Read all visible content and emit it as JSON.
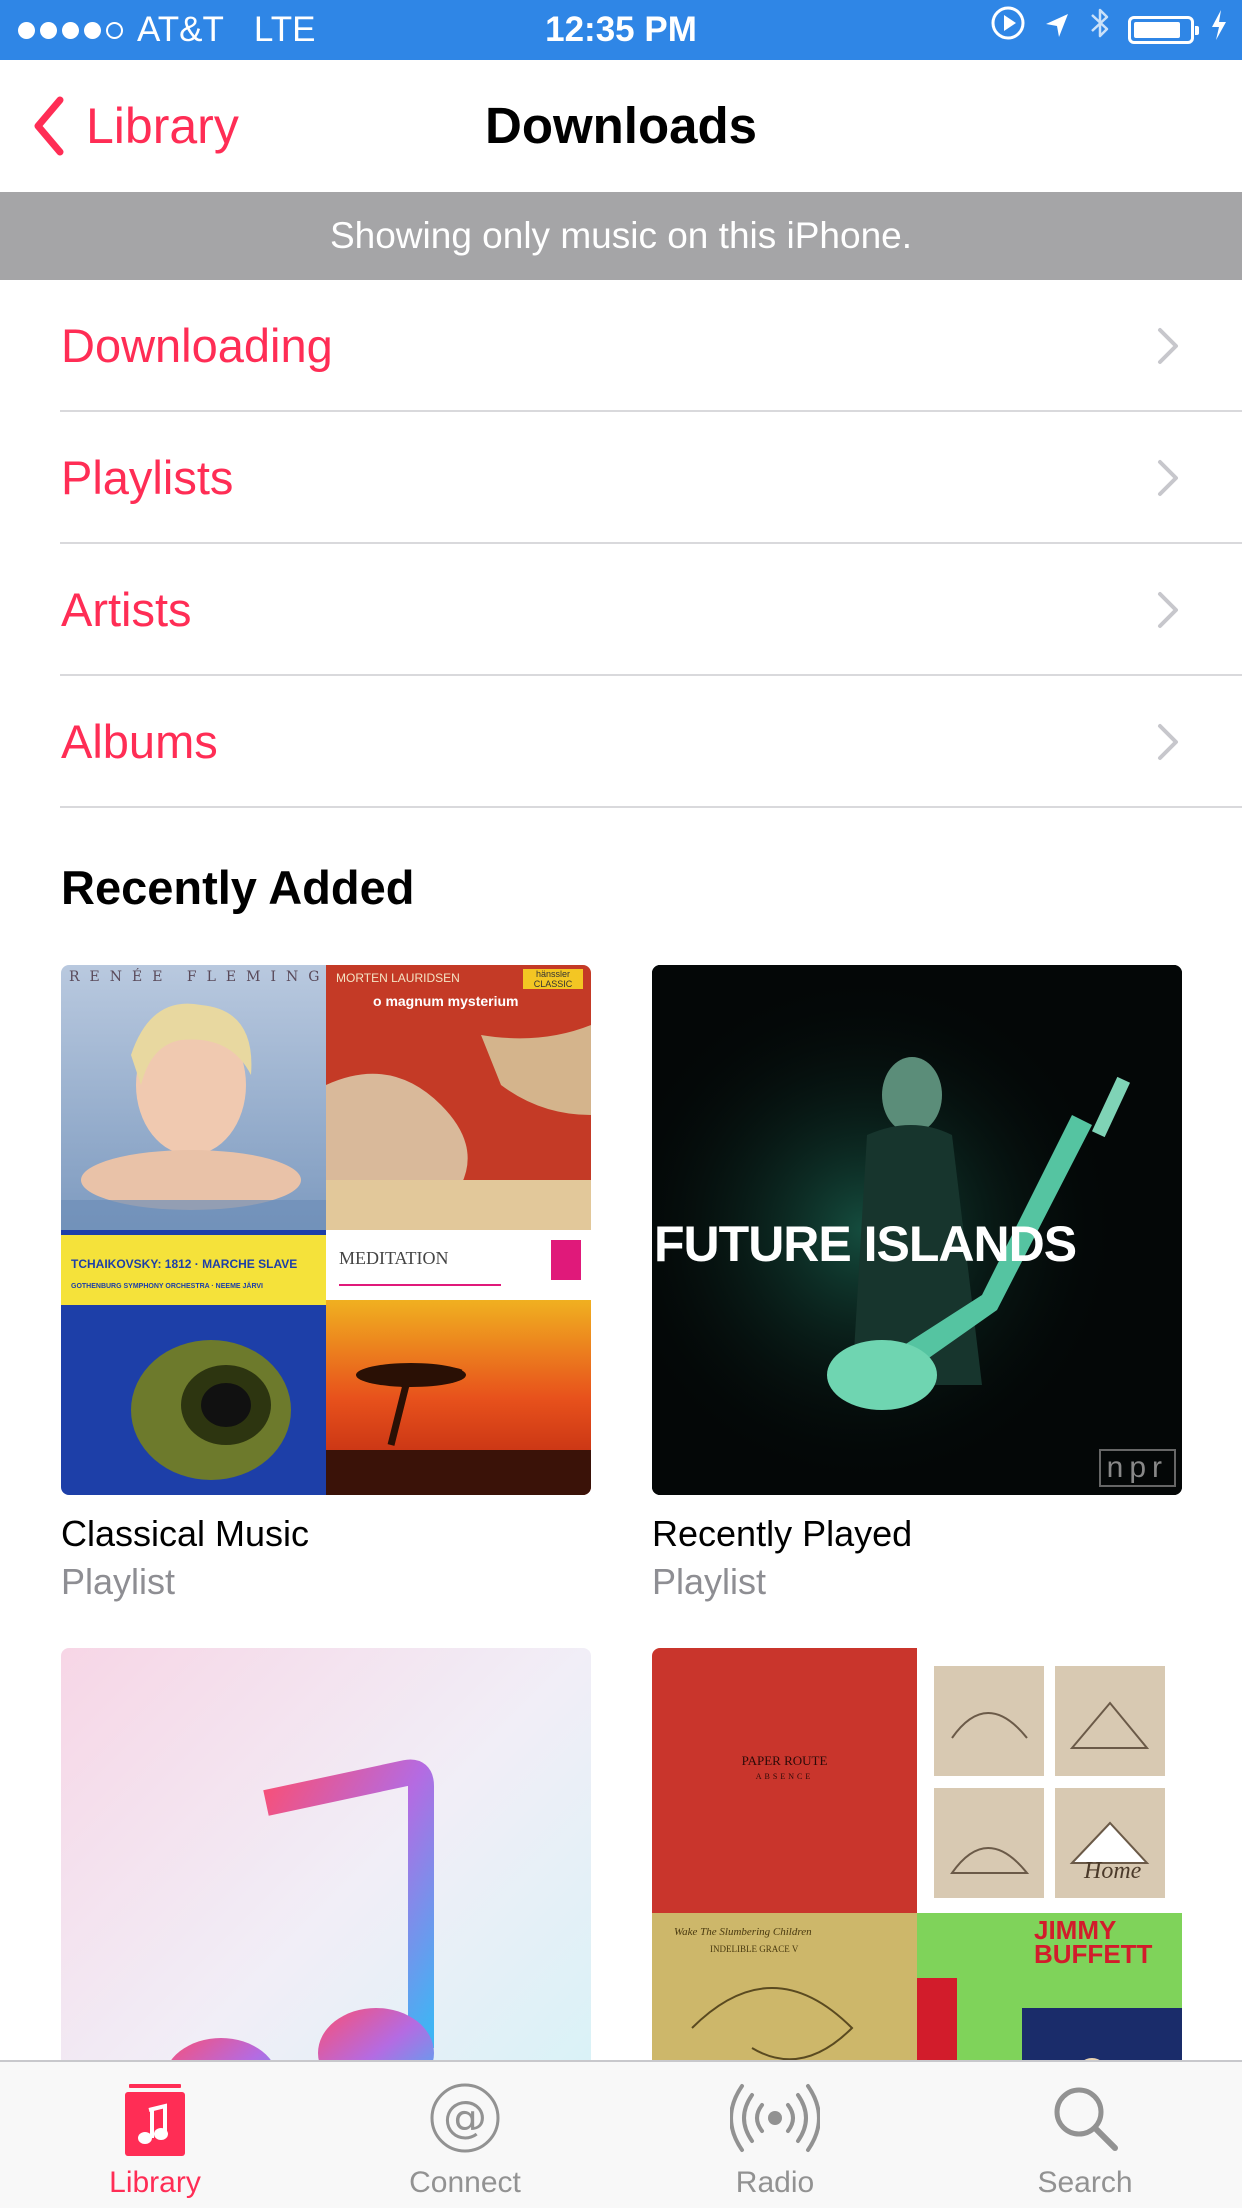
{
  "status_bar": {
    "carrier": "AT&T",
    "network": "LTE",
    "time": "12:35 PM",
    "signal_bars_filled": 4,
    "signal_bars_total": 5,
    "battery_level": 0.85,
    "icons": [
      "play-circle-icon",
      "location-arrow-icon",
      "bluetooth-icon",
      "battery-icon",
      "charging-bolt-icon"
    ]
  },
  "nav": {
    "back_label": "Library",
    "title": "Downloads"
  },
  "banner": {
    "text": "Showing only music on this iPhone."
  },
  "menu": {
    "items": [
      {
        "label": "Downloading"
      },
      {
        "label": "Playlists"
      },
      {
        "label": "Artists"
      },
      {
        "label": "Albums"
      }
    ]
  },
  "recently_added": {
    "title": "Recently Added",
    "cards": [
      {
        "title": "Classical Music",
        "subtitle": "Playlist",
        "art": {
          "q1_text": "RENÉE FLEMING",
          "q2_header": "MORTEN LAURIDSEN",
          "q2_title": "o magnum mysterium",
          "q2_badge": "hänssler CLASSIC",
          "q3_title": "TCHAIKOVSKY: 1812 · MARCHE SLAVE",
          "q3_orchestra": "GOTHENBURG SYMPHONY ORCHESTRA · NEEME JÄRVI",
          "q4_title": "MEDITATION"
        }
      },
      {
        "title": "Recently Played",
        "subtitle": "Playlist",
        "art": {
          "overlay_text": "FUTURE ISLANDS",
          "logo": "npr"
        }
      },
      {
        "title": "",
        "subtitle": "",
        "art": {
          "icon": "music-note-icon"
        }
      },
      {
        "title": "",
        "subtitle": "",
        "art": {
          "q1_title": "PAPER ROUTE",
          "q1_sub": "ABSENCE",
          "q2_text": "Home",
          "q3_title": "Wake The Slumbering Children",
          "q3_sub": "INDELIBLE GRACE V",
          "q4_title": "JIMMY BUFFETT"
        }
      }
    ]
  },
  "tab_bar": {
    "tabs": [
      {
        "label": "Library",
        "icon": "library-icon",
        "active": true
      },
      {
        "label": "Connect",
        "icon": "at-sign-icon",
        "active": false
      },
      {
        "label": "Radio",
        "icon": "radio-icon",
        "active": false
      },
      {
        "label": "Search",
        "icon": "search-icon",
        "active": false
      }
    ]
  },
  "colors": {
    "accent": "#ff2d55",
    "status_bar": "#2f86e6",
    "banner": "#a5a5a7",
    "tab_inactive": "#929292"
  }
}
